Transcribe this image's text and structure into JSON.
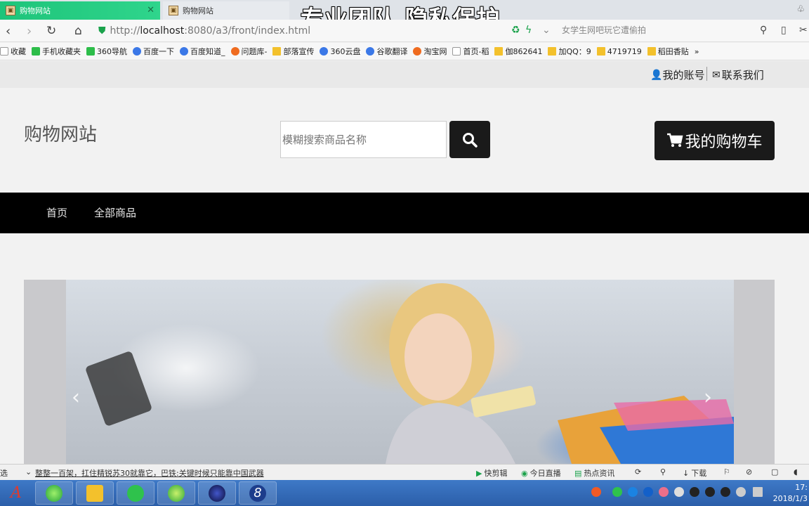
{
  "browser": {
    "active_tab_title": "购物网站",
    "inactive_tab_title": "购物网站",
    "overlay_caption": "专业团队 隐私保护",
    "url_prefix": "http://",
    "url_host": "localhost",
    "url_path": ":8080/a3/front/index.html",
    "address_search_placeholder": "女学生网吧玩它遭偷拍",
    "bookmarks": [
      {
        "label": "收藏",
        "icon": "star-icon",
        "kind": "page"
      },
      {
        "label": "手机收藏夹",
        "icon": "phone-icon",
        "kind": "green"
      },
      {
        "label": "360导航",
        "icon": "nav360-icon",
        "kind": "green"
      },
      {
        "label": "百度一下",
        "icon": "baidu-icon",
        "kind": "blue"
      },
      {
        "label": "百度知道_",
        "icon": "baidu-icon",
        "kind": "blue"
      },
      {
        "label": "问题库-",
        "icon": "sogou-icon",
        "kind": "orange"
      },
      {
        "label": "部落宣传",
        "icon": "folder-icon",
        "kind": "folder"
      },
      {
        "label": "360云盘",
        "icon": "cloud-icon",
        "kind": "blue"
      },
      {
        "label": "谷歌翻译",
        "icon": "translate-icon",
        "kind": "blue"
      },
      {
        "label": "淘宝网",
        "icon": "taobao-icon",
        "kind": "orange"
      },
      {
        "label": "首页-稻",
        "icon": "page-icon",
        "kind": "page"
      },
      {
        "label": "伽862641",
        "icon": "folder-icon",
        "kind": "folder"
      },
      {
        "label": "加QQ：9",
        "icon": "folder-icon",
        "kind": "folder"
      },
      {
        "label": "4719719",
        "icon": "folder-icon",
        "kind": "folder"
      },
      {
        "label": "稻田香贴",
        "icon": "folder-icon",
        "kind": "folder"
      }
    ],
    "bookmarks_more": "»"
  },
  "site": {
    "topbar": {
      "account": "我的账号",
      "contact": "联系我们"
    },
    "brand": "购物网站",
    "search": {
      "placeholder": "模糊搜索商品名称"
    },
    "cart_label": "我的购物车",
    "nav": [
      "首页",
      "全部商品"
    ],
    "carousel": {
      "prev": "‹",
      "next": "›"
    }
  },
  "newsbar": {
    "left_label": "选",
    "headline": "整整一百架，扛住精锐苏30就靠它，巴铁:关键时候只能靠中国武器",
    "items": [
      "快剪辑",
      "今日直播",
      "热点资讯",
      "下载"
    ]
  },
  "taskbar": {
    "time": "17:",
    "date": "2018/1/3"
  },
  "colors": {
    "tab_active": "#1ec47a",
    "nav_bg": "#000000",
    "button_dark": "#1a1a1a",
    "taskbar": "#2b5ea9"
  }
}
